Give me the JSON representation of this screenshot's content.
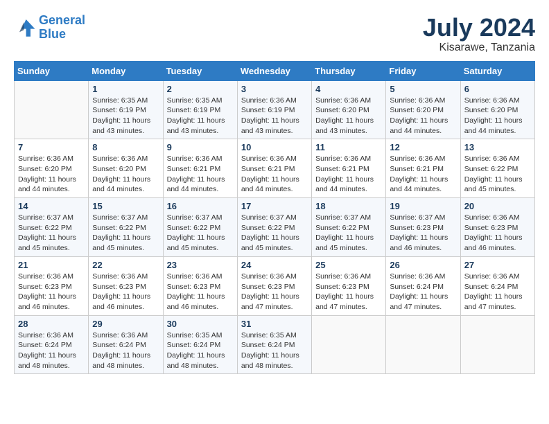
{
  "header": {
    "logo_line1": "General",
    "logo_line2": "Blue",
    "month_year": "July 2024",
    "location": "Kisarawe, Tanzania"
  },
  "calendar": {
    "days_of_week": [
      "Sunday",
      "Monday",
      "Tuesday",
      "Wednesday",
      "Thursday",
      "Friday",
      "Saturday"
    ],
    "weeks": [
      [
        {
          "day": "",
          "sunrise": "",
          "sunset": "",
          "daylight": ""
        },
        {
          "day": "1",
          "sunrise": "Sunrise: 6:35 AM",
          "sunset": "Sunset: 6:19 PM",
          "daylight": "Daylight: 11 hours and 43 minutes."
        },
        {
          "day": "2",
          "sunrise": "Sunrise: 6:35 AM",
          "sunset": "Sunset: 6:19 PM",
          "daylight": "Daylight: 11 hours and 43 minutes."
        },
        {
          "day": "3",
          "sunrise": "Sunrise: 6:36 AM",
          "sunset": "Sunset: 6:19 PM",
          "daylight": "Daylight: 11 hours and 43 minutes."
        },
        {
          "day": "4",
          "sunrise": "Sunrise: 6:36 AM",
          "sunset": "Sunset: 6:20 PM",
          "daylight": "Daylight: 11 hours and 43 minutes."
        },
        {
          "day": "5",
          "sunrise": "Sunrise: 6:36 AM",
          "sunset": "Sunset: 6:20 PM",
          "daylight": "Daylight: 11 hours and 44 minutes."
        },
        {
          "day": "6",
          "sunrise": "Sunrise: 6:36 AM",
          "sunset": "Sunset: 6:20 PM",
          "daylight": "Daylight: 11 hours and 44 minutes."
        }
      ],
      [
        {
          "day": "7",
          "sunrise": "Sunrise: 6:36 AM",
          "sunset": "Sunset: 6:20 PM",
          "daylight": "Daylight: 11 hours and 44 minutes."
        },
        {
          "day": "8",
          "sunrise": "Sunrise: 6:36 AM",
          "sunset": "Sunset: 6:20 PM",
          "daylight": "Daylight: 11 hours and 44 minutes."
        },
        {
          "day": "9",
          "sunrise": "Sunrise: 6:36 AM",
          "sunset": "Sunset: 6:21 PM",
          "daylight": "Daylight: 11 hours and 44 minutes."
        },
        {
          "day": "10",
          "sunrise": "Sunrise: 6:36 AM",
          "sunset": "Sunset: 6:21 PM",
          "daylight": "Daylight: 11 hours and 44 minutes."
        },
        {
          "day": "11",
          "sunrise": "Sunrise: 6:36 AM",
          "sunset": "Sunset: 6:21 PM",
          "daylight": "Daylight: 11 hours and 44 minutes."
        },
        {
          "day": "12",
          "sunrise": "Sunrise: 6:36 AM",
          "sunset": "Sunset: 6:21 PM",
          "daylight": "Daylight: 11 hours and 44 minutes."
        },
        {
          "day": "13",
          "sunrise": "Sunrise: 6:36 AM",
          "sunset": "Sunset: 6:22 PM",
          "daylight": "Daylight: 11 hours and 45 minutes."
        }
      ],
      [
        {
          "day": "14",
          "sunrise": "Sunrise: 6:37 AM",
          "sunset": "Sunset: 6:22 PM",
          "daylight": "Daylight: 11 hours and 45 minutes."
        },
        {
          "day": "15",
          "sunrise": "Sunrise: 6:37 AM",
          "sunset": "Sunset: 6:22 PM",
          "daylight": "Daylight: 11 hours and 45 minutes."
        },
        {
          "day": "16",
          "sunrise": "Sunrise: 6:37 AM",
          "sunset": "Sunset: 6:22 PM",
          "daylight": "Daylight: 11 hours and 45 minutes."
        },
        {
          "day": "17",
          "sunrise": "Sunrise: 6:37 AM",
          "sunset": "Sunset: 6:22 PM",
          "daylight": "Daylight: 11 hours and 45 minutes."
        },
        {
          "day": "18",
          "sunrise": "Sunrise: 6:37 AM",
          "sunset": "Sunset: 6:22 PM",
          "daylight": "Daylight: 11 hours and 45 minutes."
        },
        {
          "day": "19",
          "sunrise": "Sunrise: 6:37 AM",
          "sunset": "Sunset: 6:23 PM",
          "daylight": "Daylight: 11 hours and 46 minutes."
        },
        {
          "day": "20",
          "sunrise": "Sunrise: 6:36 AM",
          "sunset": "Sunset: 6:23 PM",
          "daylight": "Daylight: 11 hours and 46 minutes."
        }
      ],
      [
        {
          "day": "21",
          "sunrise": "Sunrise: 6:36 AM",
          "sunset": "Sunset: 6:23 PM",
          "daylight": "Daylight: 11 hours and 46 minutes."
        },
        {
          "day": "22",
          "sunrise": "Sunrise: 6:36 AM",
          "sunset": "Sunset: 6:23 PM",
          "daylight": "Daylight: 11 hours and 46 minutes."
        },
        {
          "day": "23",
          "sunrise": "Sunrise: 6:36 AM",
          "sunset": "Sunset: 6:23 PM",
          "daylight": "Daylight: 11 hours and 46 minutes."
        },
        {
          "day": "24",
          "sunrise": "Sunrise: 6:36 AM",
          "sunset": "Sunset: 6:23 PM",
          "daylight": "Daylight: 11 hours and 47 minutes."
        },
        {
          "day": "25",
          "sunrise": "Sunrise: 6:36 AM",
          "sunset": "Sunset: 6:23 PM",
          "daylight": "Daylight: 11 hours and 47 minutes."
        },
        {
          "day": "26",
          "sunrise": "Sunrise: 6:36 AM",
          "sunset": "Sunset: 6:24 PM",
          "daylight": "Daylight: 11 hours and 47 minutes."
        },
        {
          "day": "27",
          "sunrise": "Sunrise: 6:36 AM",
          "sunset": "Sunset: 6:24 PM",
          "daylight": "Daylight: 11 hours and 47 minutes."
        }
      ],
      [
        {
          "day": "28",
          "sunrise": "Sunrise: 6:36 AM",
          "sunset": "Sunset: 6:24 PM",
          "daylight": "Daylight: 11 hours and 48 minutes."
        },
        {
          "day": "29",
          "sunrise": "Sunrise: 6:36 AM",
          "sunset": "Sunset: 6:24 PM",
          "daylight": "Daylight: 11 hours and 48 minutes."
        },
        {
          "day": "30",
          "sunrise": "Sunrise: 6:35 AM",
          "sunset": "Sunset: 6:24 PM",
          "daylight": "Daylight: 11 hours and 48 minutes."
        },
        {
          "day": "31",
          "sunrise": "Sunrise: 6:35 AM",
          "sunset": "Sunset: 6:24 PM",
          "daylight": "Daylight: 11 hours and 48 minutes."
        },
        {
          "day": "",
          "sunrise": "",
          "sunset": "",
          "daylight": ""
        },
        {
          "day": "",
          "sunrise": "",
          "sunset": "",
          "daylight": ""
        },
        {
          "day": "",
          "sunrise": "",
          "sunset": "",
          "daylight": ""
        }
      ]
    ]
  }
}
